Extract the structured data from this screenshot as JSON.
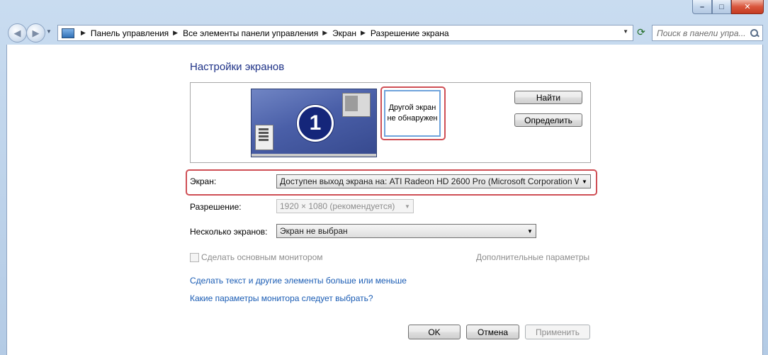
{
  "window": {
    "caption_buttons": {
      "minimize": "–",
      "maximize": "□",
      "close": "✕"
    }
  },
  "nav": {
    "back_icon": "back-arrow-icon",
    "forward_icon": "forward-arrow-icon",
    "breadcrumb": [
      "Панель управления",
      "Все элементы панели управления",
      "Экран",
      "Разрешение экрана"
    ],
    "search_placeholder": "Поиск в панели упра..."
  },
  "main": {
    "title": "Настройки экранов",
    "monitor1_number": "1",
    "monitor2_text_line1": "Другой экран",
    "monitor2_text_line2": "не обнаружен",
    "find_button": "Найти",
    "identify_button": "Определить",
    "display_label": "Экран:",
    "display_value": "Доступен выход экрана на: ATI Radeon HD 2600 Pro (Microsoft Corporation W",
    "resolution_label": "Разрешение:",
    "resolution_value": "1920 × 1080 (рекомендуется)",
    "multiple_label": "Несколько экранов:",
    "multiple_value": "Экран не выбран",
    "primary_checkbox_label": "Сделать основным монитором",
    "advanced_link": "Дополнительные параметры",
    "link_text_size": "Сделать текст и другие элементы больше или меньше",
    "link_which_params": "Какие параметры монитора следует выбрать?"
  },
  "footer": {
    "ok": "OK",
    "cancel": "Отмена",
    "apply": "Применить"
  },
  "colors": {
    "highlight": "#cf4f55",
    "link": "#1a5cb4",
    "title": "#1e3287"
  }
}
